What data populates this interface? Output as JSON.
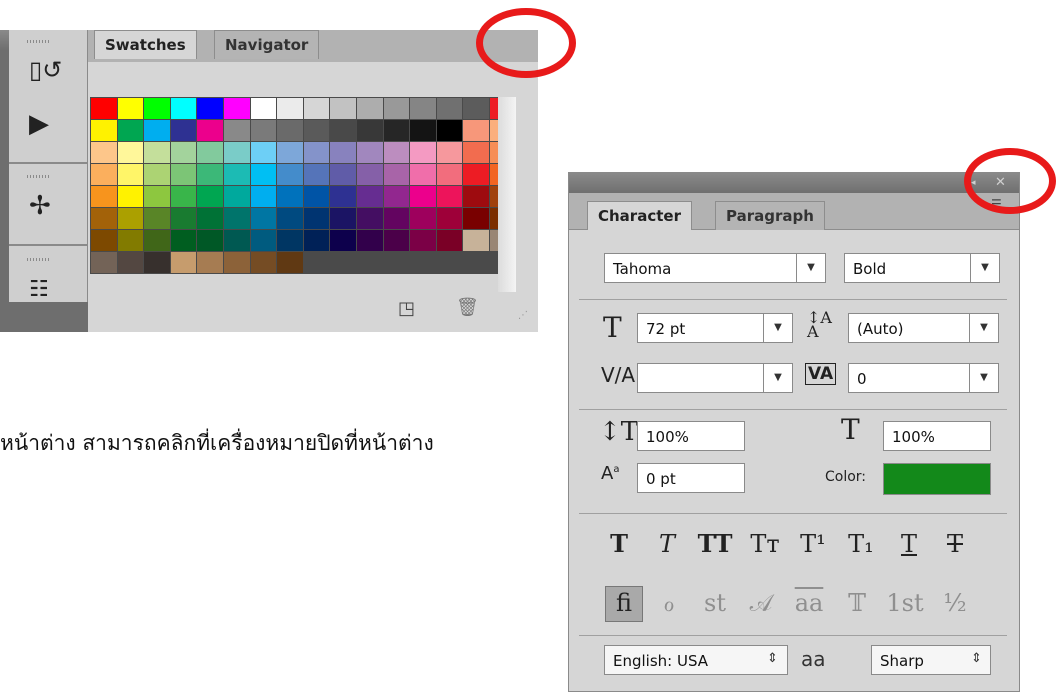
{
  "swatches_panel": {
    "tabs": [
      "Swatches",
      "Navigator"
    ],
    "collapse_icon": "double-chevron-right",
    "swatch_colors": [
      "#ff0000",
      "#ffff00",
      "#00ff00",
      "#00ffff",
      "#0000ff",
      "#ff00ff",
      "#ffffff",
      "#ebebeb",
      "#d6d6d6",
      "#c2c2c2",
      "#adadad",
      "#999999",
      "#858585",
      "#707070",
      "#5c5c5c",
      "#ed1c24",
      "#fff200",
      "#00a651",
      "#00aeef",
      "#2e3192",
      "#ec008c",
      "#898989",
      "#7a7a7a",
      "#6a6a6a",
      "#5a5a5a",
      "#494949",
      "#383838",
      "#262626",
      "#141414",
      "#000000",
      "#f7977a",
      "#fbaf7d",
      "#fdc68a",
      "#fff79a",
      "#c4df9b",
      "#a3d39c",
      "#82ca9d",
      "#7accc8",
      "#6dcff6",
      "#7da7d9",
      "#8493ca",
      "#8882be",
      "#a187be",
      "#bc8dbf",
      "#f49ac2",
      "#f6989d",
      "#f26c4f",
      "#f68e56",
      "#fbaf5d",
      "#fff568",
      "#acd373",
      "#7cc576",
      "#3cb878",
      "#1cbbb4",
      "#00bff3",
      "#448ccb",
      "#5574b9",
      "#605ca8",
      "#8560a8",
      "#a864a8",
      "#f06eaa",
      "#f26d7d",
      "#ed1c24",
      "#f26522",
      "#f7941d",
      "#fff200",
      "#8dc73f",
      "#39b54a",
      "#00a651",
      "#00a99d",
      "#00aeef",
      "#0072bc",
      "#0054a6",
      "#2e3192",
      "#662d91",
      "#92278f",
      "#ec008c",
      "#ed145b",
      "#9e0b0f",
      "#a0410d",
      "#a36209",
      "#aba000",
      "#598527",
      "#197b30",
      "#007236",
      "#00746b",
      "#0076a3",
      "#004a80",
      "#003471",
      "#1b1464",
      "#440e62",
      "#630460",
      "#9e005d",
      "#9e0039",
      "#790000",
      "#7b2e00",
      "#7d4900",
      "#827b00",
      "#406618",
      "#005e20",
      "#005826",
      "#005952",
      "#005b7f",
      "#003663",
      "#002157",
      "#0d004c",
      "#32004b",
      "#4b0049",
      "#7b0046",
      "#7a0026",
      "#c7b299",
      "#998675",
      "#736357",
      "#534741",
      "#37302d",
      "#c69c6d",
      "#a67c52",
      "#8c6239",
      "#754c24",
      "#603913"
    ]
  },
  "character_panel": {
    "tabs": [
      "Character",
      "Paragraph"
    ],
    "font_family": "Tahoma",
    "font_style": "Bold",
    "font_size": "72 pt",
    "leading": "(Auto)",
    "kerning": "",
    "tracking": "0",
    "vertical_scale": "100%",
    "horizontal_scale": "100%",
    "baseline_shift": "0 pt",
    "color_label": "Color:",
    "color_value": "#13891a",
    "style_buttons": [
      "T",
      "T",
      "TT",
      "Tт",
      "T¹",
      "T₁",
      "T",
      "T"
    ],
    "opentype_buttons": [
      "fi",
      "ℴ",
      "st",
      "𝒜",
      "aa",
      "𝕋",
      "1st",
      "½"
    ],
    "language": "English: USA",
    "aa_icon": "aa",
    "anti_alias": "Sharp"
  },
  "caption": "หน้าต่าง สามารถคลิกที่เครื่องหมายปิดที่หน้าต่าง",
  "annotation_color": "#e81a1a"
}
